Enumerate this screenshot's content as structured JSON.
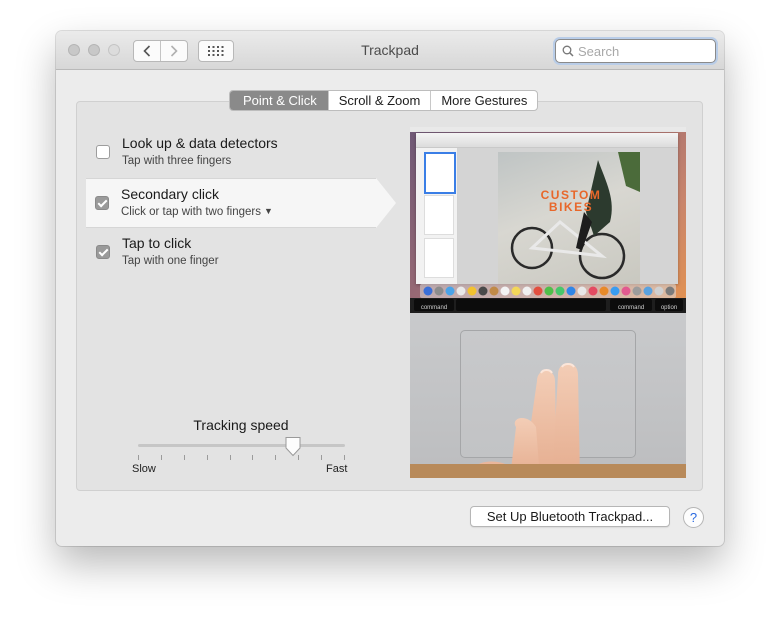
{
  "window": {
    "title": "Trackpad"
  },
  "toolbar": {
    "back_icon": "chevron-left-icon",
    "forward_icon": "chevron-right-icon",
    "show_all_icon": "grid-icon",
    "search_placeholder": "Search",
    "search_value": ""
  },
  "tabs": [
    {
      "label": "Point & Click",
      "active": true
    },
    {
      "label": "Scroll & Zoom",
      "active": false
    },
    {
      "label": "More Gestures",
      "active": false
    }
  ],
  "options": [
    {
      "title": "Look up & data detectors",
      "subtitle": "Tap with three fingers",
      "checked": false,
      "selected": false
    },
    {
      "title": "Secondary click",
      "subtitle": "Click or tap with two fingers",
      "checked": true,
      "selected": true,
      "has_dropdown": true
    },
    {
      "title": "Tap to click",
      "subtitle": "Tap with one finger",
      "checked": true,
      "selected": false
    }
  ],
  "tracking": {
    "label": "Tracking speed",
    "min_label": "Slow",
    "max_label": "Fast",
    "value_fraction": 0.75,
    "tick_count": 10
  },
  "preview": {
    "poster_title_line1": "CUSTOM",
    "poster_title_line2": "BIKES",
    "key_left": "command",
    "key_right": "command",
    "key_option": "option"
  },
  "footer": {
    "setup_button": "Set Up Bluetooth Trackpad...",
    "help_label": "?"
  },
  "colors": {
    "accent_checkbox": "#9a9a9a",
    "poster_orange": "#e8672a",
    "help_blue": "#2a6ae0"
  }
}
